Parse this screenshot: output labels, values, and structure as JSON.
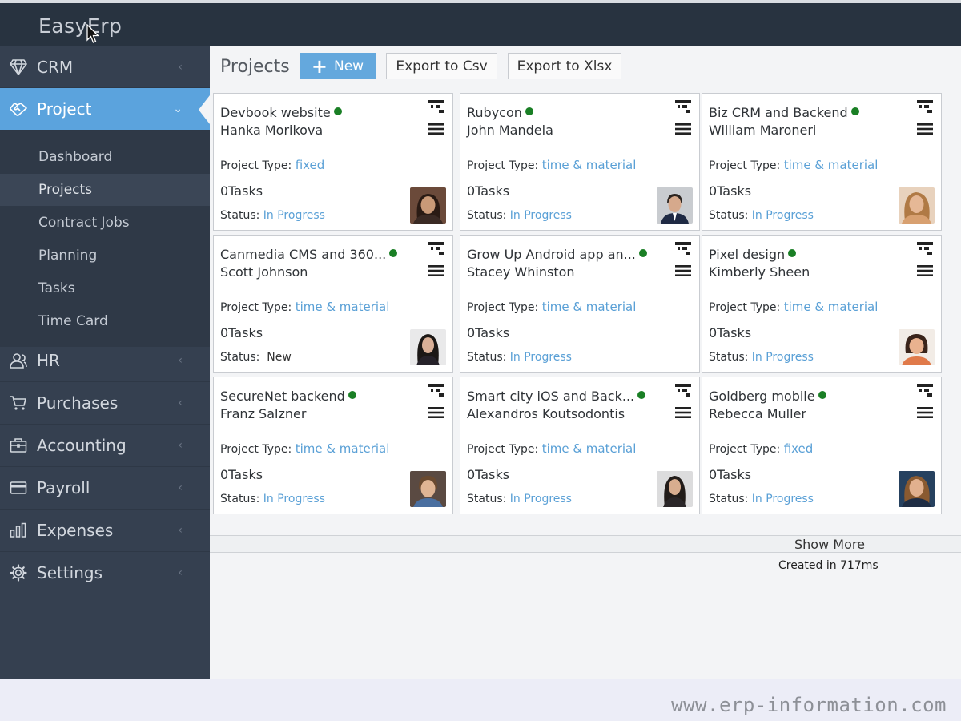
{
  "app": {
    "brand": "EasyErp"
  },
  "sidebar": {
    "items": [
      {
        "label": "CRM",
        "icon": "diamond-icon"
      },
      {
        "label": "Project",
        "icon": "handshake-icon",
        "active": true
      },
      {
        "label": "HR",
        "icon": "users-icon"
      },
      {
        "label": "Purchases",
        "icon": "cart-icon"
      },
      {
        "label": "Accounting",
        "icon": "briefcase-icon"
      },
      {
        "label": "Payroll",
        "icon": "credit-card-icon"
      },
      {
        "label": "Expenses",
        "icon": "bar-chart-icon"
      },
      {
        "label": "Settings",
        "icon": "gear-icon"
      }
    ],
    "subitems": [
      {
        "label": "Dashboard"
      },
      {
        "label": "Projects",
        "active": true
      },
      {
        "label": "Contract Jobs"
      },
      {
        "label": "Planning"
      },
      {
        "label": "Tasks"
      },
      {
        "label": "Time Card"
      }
    ]
  },
  "toolbar": {
    "title": "Projects",
    "new_label": "New",
    "export_csv_label": "Export to Csv",
    "export_xlsx_label": "Export to Xlsx"
  },
  "labels": {
    "project_type": "Project Type:",
    "status": "Status:"
  },
  "cards": [
    {
      "name": "Devbook website",
      "owner": "Hanka Morikova",
      "type": "fixed",
      "tasks": "0Tasks",
      "status": "In Progress",
      "colors": {
        "bg": "#6b4a3a",
        "skin": "#c99a78",
        "hair": "#2a1b14",
        "shirt": "#3a2a24"
      }
    },
    {
      "name": "Rubycon",
      "owner": "John Mandela",
      "type": "time & material",
      "tasks": "0Tasks",
      "status": "In Progress",
      "colors": {
        "bg": "#c9ccd0",
        "skin": "#d6a98c",
        "hair": "#2b2420",
        "shirt": "#1f2a44"
      }
    },
    {
      "name": "Biz CRM and Backend",
      "owner": "William Maroneri",
      "type": "time & material",
      "tasks": "0Tasks",
      "status": "In Progress",
      "colors": {
        "bg": "#e8d2bd",
        "skin": "#e6b896",
        "hair": "#b07a45",
        "shirt": "#d8a070"
      }
    },
    {
      "name": "Canmedia CMS and 360...",
      "owner": "Scott Johnson",
      "type": "time & material",
      "tasks": "0Tasks",
      "status": "New",
      "colors": {
        "bg": "#e9e9ea",
        "skin": "#d9b098",
        "hair": "#1c1816",
        "shirt": "#26222a"
      }
    },
    {
      "name": "Grow Up Android app an...",
      "owner": "Stacey Whinston",
      "type": "time & material",
      "tasks": "0Tasks",
      "status": "In Progress",
      "colors": {}
    },
    {
      "name": "Pixel design",
      "owner": "Kimberly Sheen",
      "type": "time & material",
      "tasks": "0Tasks",
      "status": "In Progress",
      "colors": {
        "bg": "#f2ece6",
        "skin": "#e9b28f",
        "hair": "#3a241a",
        "shirt": "#e07a4a"
      }
    },
    {
      "name": "SecureNet backend",
      "owner": "Franz Salzner",
      "type": "time & material",
      "tasks": "0Tasks",
      "status": "In Progress",
      "colors": {
        "bg": "#5a4a42",
        "skin": "#e0b594",
        "hair": "#6a4a30",
        "shirt": "#4a6fa0"
      }
    },
    {
      "name": "Smart city iOS and Back...",
      "owner": "Alexandros Koutsodontis",
      "type": "time & material",
      "tasks": "0Tasks",
      "status": "In Progress",
      "colors": {
        "bg": "#dcdcdd",
        "skin": "#d8ad8f",
        "hair": "#221c19",
        "shirt": "#2a2628"
      }
    },
    {
      "name": "Goldberg mobile",
      "owner": "Rebecca Muller",
      "type": "fixed",
      "tasks": "0Tasks",
      "status": "In Progress",
      "colors": {
        "bg": "#26415f",
        "skin": "#e1b08e",
        "hair": "#8a5a30",
        "shirt": "#1f2d44"
      }
    }
  ],
  "footer": {
    "show_more": "Show More",
    "created": "Created in 717ms"
  },
  "watermark": "www.erp-information.com"
}
